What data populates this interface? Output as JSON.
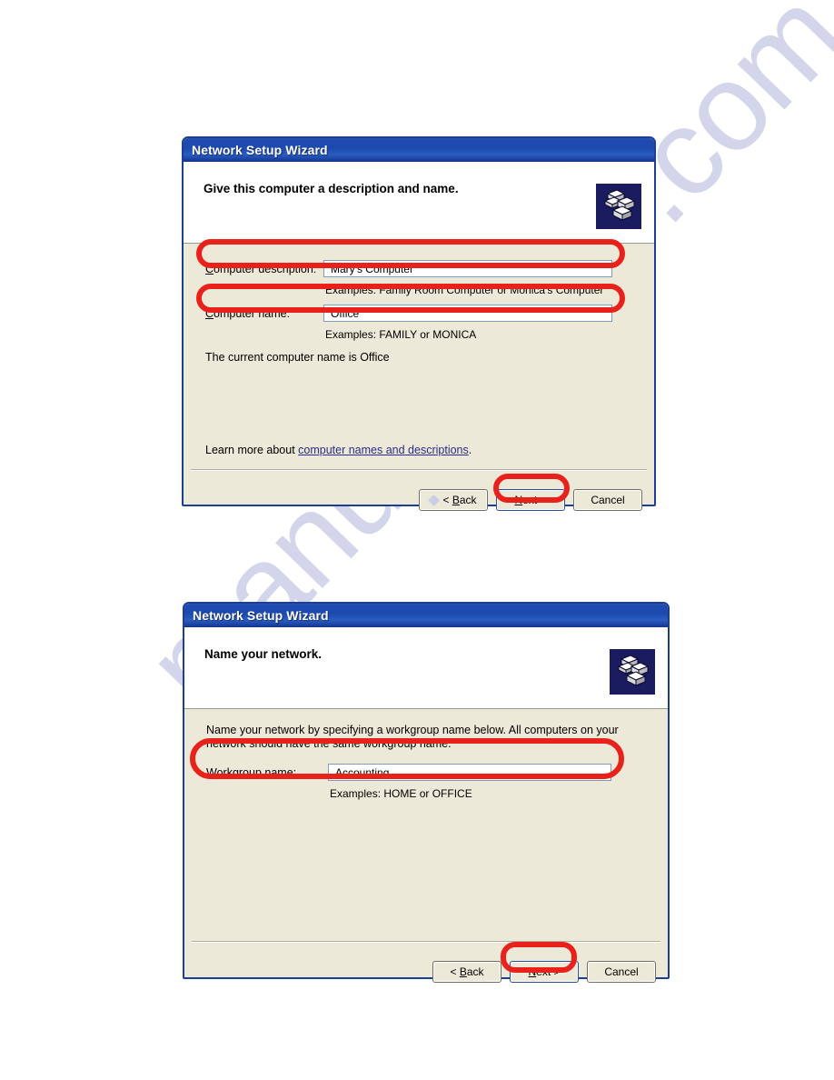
{
  "page": {
    "background": "#ffffff",
    "watermark_text": "manualshive.com",
    "watermark_color": "#b9bce0"
  },
  "theme": {
    "titlebar_blue": "#1d49ae",
    "dialog_border": "#1c3f94",
    "dialog_face": "#ece9d8",
    "highlight_red": "#e8211b",
    "link_color": "#2b2b8c",
    "input_border": "#7f9db9"
  },
  "dialog1": {
    "title": "Network Setup Wizard",
    "heading": "Give this computer a description and name.",
    "icon": "two-networked-computers-icon",
    "fields": [
      {
        "label": "Computer description:",
        "accel": "C",
        "value": "Mary's Computer",
        "example": "Examples: Family Room Computer or Monica's Computer"
      },
      {
        "label": "Computer name:",
        "accel": "C",
        "value": "Office",
        "example": "Examples: FAMILY or MONICA"
      }
    ],
    "current_name_text": "The current computer name is Office",
    "learn_more_prefix": "Learn more about ",
    "learn_more_link": "computer names and descriptions",
    "learn_more_suffix": ".",
    "buttons": {
      "back": "< Back",
      "back_accel": "B",
      "next": "Next >",
      "next_accel": "N",
      "cancel": "Cancel"
    }
  },
  "dialog2": {
    "title": "Network Setup Wizard",
    "heading": "Name your network.",
    "icon": "two-networked-computers-icon",
    "body_text": "Name your network by specifying a workgroup name below. All computers on your network should have the same workgroup name.",
    "fields": [
      {
        "label": "Workgroup name:",
        "accel": "W",
        "value": "Accounting",
        "example": "Examples: HOME or OFFICE"
      }
    ],
    "buttons": {
      "back": "< Back",
      "back_accel": "B",
      "next": "Next >",
      "next_accel": "N",
      "cancel": "Cancel"
    }
  }
}
